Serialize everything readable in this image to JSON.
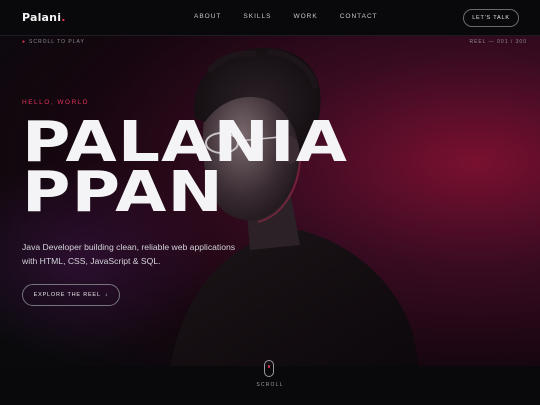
{
  "header": {
    "logo_text": "Palani",
    "logo_dot": ".",
    "nav": [
      "ABOUT",
      "SKILLS",
      "WORK",
      "CONTACT"
    ],
    "cta_label": "LET'S TALK"
  },
  "subbar": {
    "left_label": "SCROLL TO PLAY",
    "right_label": "REEL — 001 / 300"
  },
  "hero": {
    "eyebrow": "HELLO, WORLD",
    "headline_line1": "PALANIA",
    "headline_line2": "PPAN",
    "description": "Java Developer building clean, reliable web applications with HTML, CSS, JavaScript & SQL.",
    "button_label": "EXPLORE THE REEL",
    "button_arrow": "↓"
  },
  "footer": {
    "scroll_label": "SCROLL"
  },
  "colors": {
    "accent": "#e0335a",
    "background": "#0a0a0d",
    "glow": "#7a1030"
  }
}
